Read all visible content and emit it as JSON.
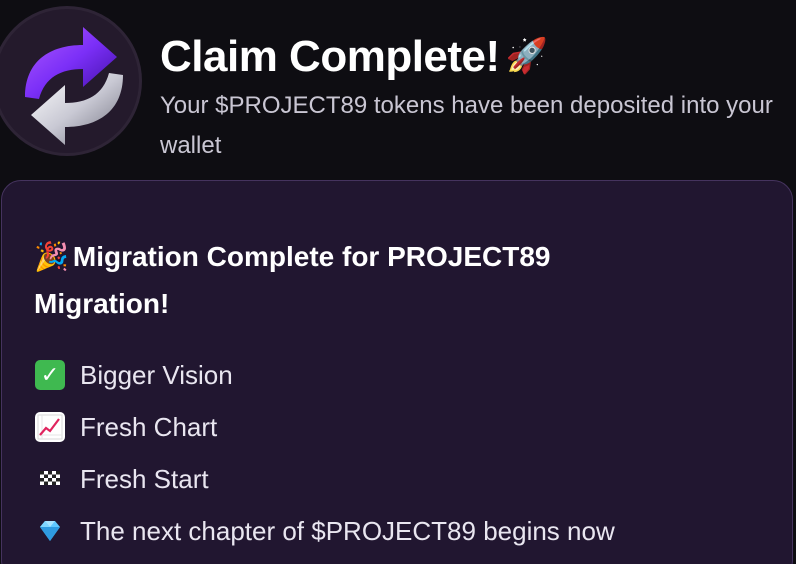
{
  "header": {
    "title": "Claim Complete!",
    "title_emoji": "🚀",
    "subtitle": "Your $PROJECT89 tokens have been deposited into your wallet"
  },
  "card": {
    "heading_emoji": "🎉",
    "heading": "Migration Complete for PROJECT89 Migration!",
    "items": [
      {
        "icon": "check-mark-icon",
        "text": "Bigger Vision"
      },
      {
        "icon": "chart-increasing-icon",
        "text": "Fresh Chart"
      },
      {
        "icon": "checkered-flag-icon",
        "text": "Fresh Start"
      },
      {
        "icon": "gem-icon",
        "text": "The next chapter of $PROJECT89 begins now"
      }
    ]
  },
  "colors": {
    "background": "#0e0d12",
    "card_background": "#211630",
    "card_border": "#45335e",
    "logo_purple": "#7b2ff7",
    "logo_silver": "#d6d6de"
  }
}
